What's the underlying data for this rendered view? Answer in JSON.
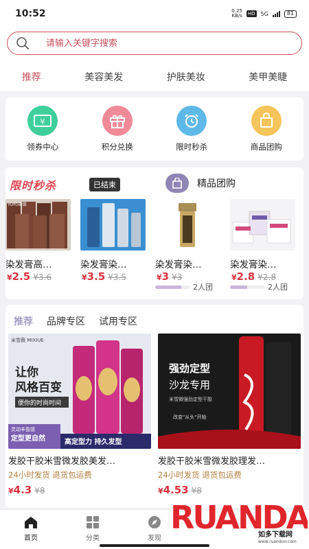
{
  "status_bar": {
    "time": "10:52",
    "net_speed": "0.25",
    "net_unit": "KB/s",
    "hd": "HD",
    "network": "5G",
    "battery": "81"
  },
  "search": {
    "placeholder": "请输入关键字搜索"
  },
  "top_tabs": [
    {
      "label": "推荐",
      "active": true
    },
    {
      "label": "美容美发"
    },
    {
      "label": "护肤美妆"
    },
    {
      "label": "美甲美睫"
    }
  ],
  "quick_actions": [
    {
      "label": "领券中心",
      "icon": "coupon-icon",
      "color": "#3fcf9a"
    },
    {
      "label": "积分兑换",
      "icon": "gift-icon",
      "color": "#f08a98"
    },
    {
      "label": "限时秒杀",
      "icon": "alarm-clock-icon",
      "color": "#5fb9e8"
    },
    {
      "label": "商品团购",
      "icon": "shopping-bag-icon",
      "color": "#f5c45a"
    }
  ],
  "flash_sale": {
    "title": "限时秒杀",
    "status": "已结束",
    "items": [
      {
        "name": "染发膏高…",
        "price": "2.5",
        "old_price": "¥3.6"
      },
      {
        "name": "染发膏染…",
        "price": "3.5",
        "old_price": "¥3.5"
      }
    ]
  },
  "group_buy": {
    "title": "精品团购",
    "items": [
      {
        "name": "染发膏染…",
        "price": "3",
        "old_price": "¥3",
        "people": "2人团",
        "progress": 0.75
      },
      {
        "name": "染发膏染…",
        "price": "2.8",
        "old_price": "¥2.8",
        "people": "2人团",
        "progress": 0.5
      }
    ]
  },
  "recommend": {
    "tabs": [
      {
        "label": "推荐",
        "active": true
      },
      {
        "label": "品牌专区"
      },
      {
        "label": "试用专区"
      }
    ],
    "products": [
      {
        "name": "发胶干胶米雪微发胶美发…",
        "tags": "24小时发货 退货包运费",
        "price": "4.3",
        "old_price": "¥8",
        "img_brand": "米雪薇 MIXIUE",
        "img_headline": "让你",
        "img_headline2": "风格百变",
        "img_sub": "便你的时尚时间",
        "img_bottom": "高定型力 持久发型",
        "img_bottom_left": "定型更自然",
        "img_bottom_left_small": "灵动丰盈感"
      },
      {
        "name": "发胶干胶米雪微发胶理发…",
        "tags": "24小时发货 退货包运费",
        "price": "4.53",
        "old_price": "¥8",
        "img_headline": "强劲定型",
        "img_headline2": "沙龙专用",
        "img_small": "米雪微强劲定型干胶",
        "img_sub": "改变\"从头\"开始"
      }
    ]
  },
  "bottom_nav": [
    {
      "label": "首页",
      "icon": "home-icon",
      "active": true
    },
    {
      "label": "分类",
      "icon": "grid-icon"
    },
    {
      "label": "发现",
      "icon": "compass-icon"
    }
  ],
  "watermark": {
    "logo": "RUANDADO",
    "subtitle": "如多下载网",
    "url": "www.ruanduo.com"
  }
}
